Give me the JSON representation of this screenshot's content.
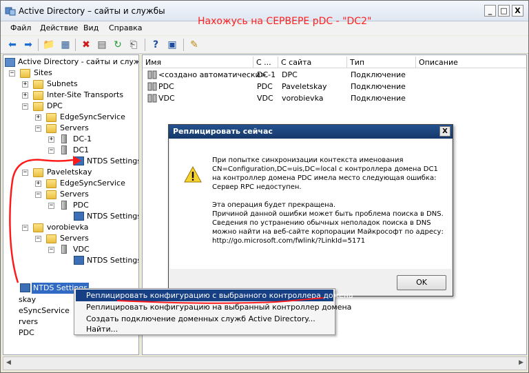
{
  "window": {
    "title": "Active Directory – сайты и службы",
    "annotation": "Нахожусь на СЕРВЕРЕ pDC - \"DC2\"",
    "minimize": "_",
    "maximize": "□",
    "close": "X"
  },
  "menu": [
    "Файл",
    "Действие",
    "Вид",
    "Справка"
  ],
  "toolbar": {
    "icons": [
      "back-arrow-icon",
      "forward-arrow-icon",
      "up-folder-icon",
      "show-hide-tree-icon",
      "delete-icon",
      "properties-icon",
      "refresh-icon",
      "export-list-icon",
      "help-icon",
      "console-icon",
      "action-icon"
    ]
  },
  "tree": {
    "root": "Active Directory - сайты и службы",
    "sites": "Sites",
    "subnets": "Subnets",
    "inter_site": "Inter-Site Transports",
    "dpc": "DPC",
    "edge1": "EdgeSyncService",
    "servers1": "Servers",
    "dc1": "DC-1",
    "dc1b": "DC1",
    "ntds1": "NTDS Settings",
    "paveletskay": "Paveletskay",
    "edge2": "EdgeSyncService",
    "servers2": "Servers",
    "pdc": "PDC",
    "ntds2": "NTDS Settings",
    "vorobievka": "vorobievka",
    "servers3": "Servers",
    "vdc": "VDC",
    "ntds3": "NTDS Settings",
    "ntds_sel": "NTDS Settings",
    "partial1": "skay",
    "partial2": "eSyncService",
    "partial3": "rvers",
    "partial4": "PDC"
  },
  "list": {
    "headers": [
      "Имя",
      "С ...",
      "С сайта",
      "Тип",
      "Описание"
    ],
    "rows": [
      [
        "<создано автоматически>",
        "DC-1",
        "DPC",
        "Подключение",
        ""
      ],
      [
        "PDC",
        "PDC",
        "Paveletskay",
        "Подключение",
        ""
      ],
      [
        "VDC",
        "VDC",
        "vorobievka",
        "Подключение",
        ""
      ]
    ]
  },
  "dialog": {
    "title": "Реплицировать сейчас",
    "close": "X",
    "lines": [
      "При попытке синхронизации контекста именования",
      "CN=Configuration,DC=uis,DC=local с контроллера домена DC1",
      "на контроллер домена PDC имела место следующая ошибка:",
      "Сервер RPC недоступен.",
      "",
      "Эта операция будет прекращена.",
      "Причиной данной ошибки может быть проблема поиска в DNS.",
      "Сведения по устранению обычных неполадок поиска в DNS",
      "можно найти на веб-сайте корпорации Майкрософт по адресу:",
      "http://go.microsoft.com/fwlink/?LinkId=5171"
    ],
    "ok": "OK"
  },
  "context_menu": {
    "items": [
      "Реплицировать конфигурацию с выбранного контроллера домена",
      "Реплицировать конфигурацию на выбранный контроллер домена",
      "Создать подключение доменных служб Active Directory...",
      "Найти..."
    ]
  },
  "colors": {
    "annotation": "#ff2020",
    "selection": "#316ac5",
    "menu_highlight": "#173f84",
    "dialog_title": "#1d4780"
  }
}
